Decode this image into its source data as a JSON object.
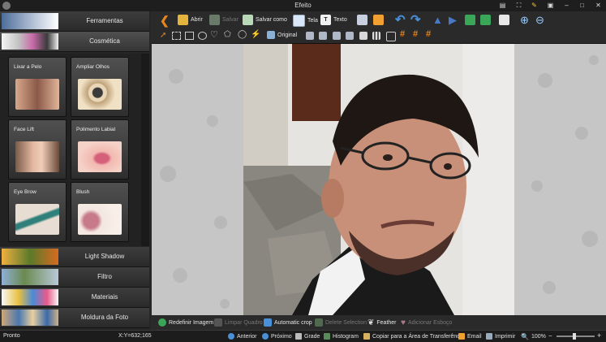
{
  "window": {
    "title": "Efeito"
  },
  "sidebar": {
    "categories_top": [
      {
        "label": "Ferramentas"
      },
      {
        "label": "Cosmética"
      }
    ],
    "effects": [
      {
        "label": "Lixar a Pelo",
        "thumb": "face-skin-thumb"
      },
      {
        "label": "Ampliar Olhos",
        "thumb": "eye-magnifier-thumb"
      },
      {
        "label": "Face Lift",
        "thumb": "face-lift-thumb"
      },
      {
        "label": "Polimento Labial",
        "thumb": "lips-thumb"
      },
      {
        "label": "Eye Brow",
        "thumb": "eyebrow-brush-thumb"
      },
      {
        "label": "Blush",
        "thumb": "blush-brush-thumb"
      }
    ],
    "categories_bottom": [
      {
        "label": "Light Shadow"
      },
      {
        "label": "Filtro"
      },
      {
        "label": "Materiais"
      },
      {
        "label": "Moldura da Foto"
      }
    ]
  },
  "toolbar": {
    "open": "Abrir",
    "save": "Salvar",
    "save_as": "Salvar como",
    "screen": "Tela",
    "text": "Texto",
    "original": "Original"
  },
  "actions": {
    "reset": "Redefinir Imagem",
    "clear_frame": "Limpar Quadro",
    "auto_crop": "Automatic crop",
    "delete_selection": "Delete Selection",
    "feather": "Feather",
    "add_sketch": "Adicionar Esboço"
  },
  "status": {
    "state": "Pronto",
    "coords": "X:Y=632;165",
    "previous": "Anterior",
    "next": "Próximo",
    "grid": "Grade",
    "histogram": "Histogram",
    "copy": "Copiar para a Área de Transferência",
    "email": "Email",
    "print": "Imprimir",
    "zoom": "100%"
  },
  "colors": {
    "accent_orange": "#e8861c",
    "accent_blue": "#4a90d9",
    "accent_green": "#3aa657"
  }
}
